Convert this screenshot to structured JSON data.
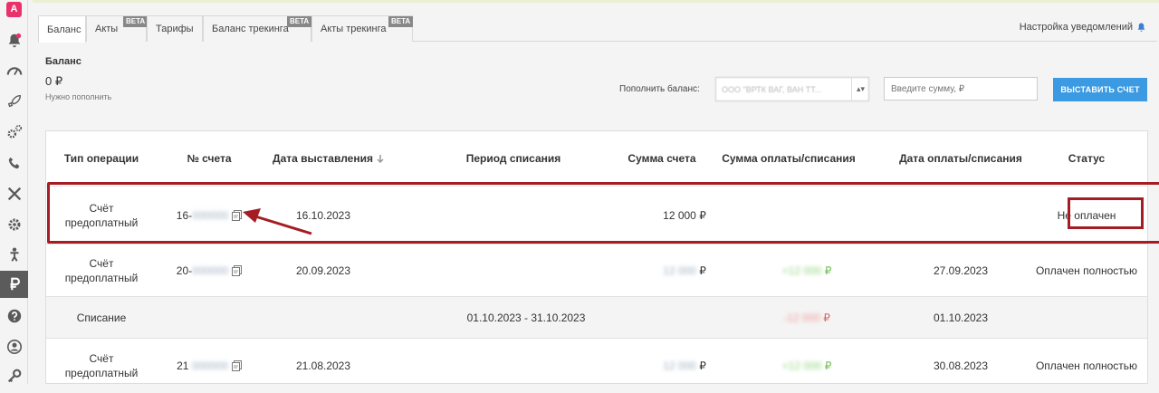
{
  "sidebar": {
    "logo": "A",
    "items": [
      "bell-icon",
      "gauge-icon",
      "rocket-icon",
      "gears-icon",
      "phone-icon",
      "tools-icon",
      "gear-icon",
      "person-icon",
      "ruble-icon",
      "help-icon",
      "user-circle-icon",
      "key-icon"
    ]
  },
  "tabs": [
    {
      "label": "Баланс",
      "beta": ""
    },
    {
      "label": "Акты",
      "beta": "BETA"
    },
    {
      "label": "Тарифы",
      "beta": ""
    },
    {
      "label": "Баланс трекинга",
      "beta": "BETA"
    },
    {
      "label": "Акты трекинга",
      "beta": "BETA"
    }
  ],
  "notifications_label": "Настройка уведомлений",
  "balance": {
    "title": "Баланс",
    "amount": "0 ₽",
    "note": "Нужно пополнить"
  },
  "topup": {
    "label": "Пополнить баланс:",
    "select_value": "ООО \"ВРТК ВАГ, ВАН ТТ...",
    "amount_placeholder": "Введите сумму, ₽",
    "button_label": "ВЫСТАВИТЬ СЧЕТ"
  },
  "table": {
    "headers": [
      "Тип операции",
      "№ счета",
      "Дата выставления",
      "Период списания",
      "Сумма счета",
      "Сумма оплаты/списания",
      "Дата оплаты/списания",
      "Статус"
    ],
    "rows": [
      {
        "type": "Счёт предоплатный",
        "number": "16-",
        "number_hidden": "000000",
        "issued": "16.10.2023",
        "period": "",
        "amount": "12 000 ₽",
        "amount_hidden": "",
        "paid": "",
        "paid_hidden": "",
        "paid_date": "",
        "status": "Не оплачен"
      },
      {
        "type": "Счёт предоплатный",
        "number": "20-",
        "number_hidden": "000000",
        "issued": "20.09.2023",
        "period": "",
        "amount": "₽",
        "amount_hidden": "12 000",
        "paid": "₽",
        "paid_hidden": "+12 000",
        "paid_date": "27.09.2023",
        "status": "Оплачен полностью"
      },
      {
        "type": "Списание",
        "number": "",
        "number_hidden": "",
        "issued": "",
        "period": "01.10.2023 - 31.10.2023",
        "amount": "",
        "amount_hidden": "",
        "paid": "₽",
        "paid_hidden": "-12 000",
        "paid_date": "01.10.2023",
        "status": ""
      },
      {
        "type": "Счёт предоплатный",
        "number": "21",
        "number_hidden": "000000",
        "issued": "21.08.2023",
        "period": "",
        "amount": "₽",
        "amount_hidden": "12 000",
        "paid": "₽",
        "paid_hidden": "+12 000",
        "paid_date": "30.08.2023",
        "status": "Оплачен полностью"
      }
    ]
  },
  "colors": {
    "accent": "#3b9ae1",
    "highlight": "#a51d24",
    "logo": "#e8336a",
    "positive": "#6bbf4e",
    "negative": "#e06060"
  }
}
